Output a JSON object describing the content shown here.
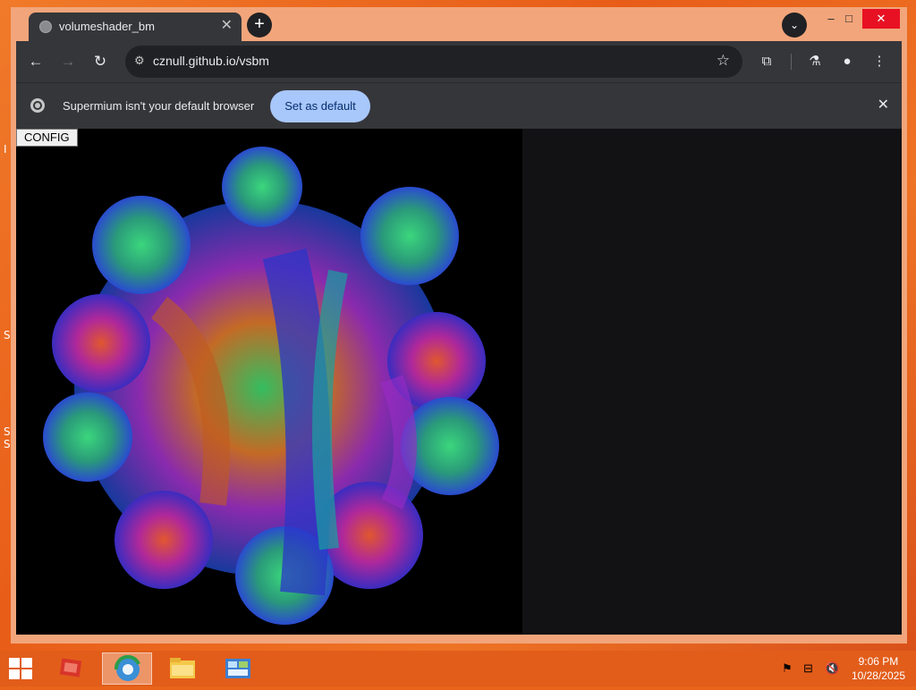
{
  "desktop": {
    "fragments": [
      "I",
      "S",
      "S",
      "S"
    ]
  },
  "browser": {
    "tab": {
      "title": "volumeshader_bm",
      "close_glyph": "✕"
    },
    "new_tab_glyph": "+",
    "tab_search_glyph": "⌄",
    "window_controls": {
      "minimize": "–",
      "maximize": "□",
      "close": "✕"
    },
    "toolbar": {
      "back": "←",
      "forward": "→",
      "reload": "↻",
      "site_info": "⚙",
      "url": "cznull.github.io/vsbm",
      "bookmark": "☆",
      "extensions": "⧉",
      "labs": "⚗",
      "profile": "●",
      "menu": "⋮"
    },
    "infobar": {
      "message": "Supermium isn't your default browser",
      "button": "Set as default",
      "close": "✕"
    }
  },
  "page": {
    "config_button": "CONFIG"
  },
  "taskbar": {
    "clock": {
      "time": "9:06 PM",
      "date": "10/28/2025"
    },
    "tray": {
      "flag": "⚑",
      "network": "⊟",
      "volume": "🔇"
    }
  }
}
